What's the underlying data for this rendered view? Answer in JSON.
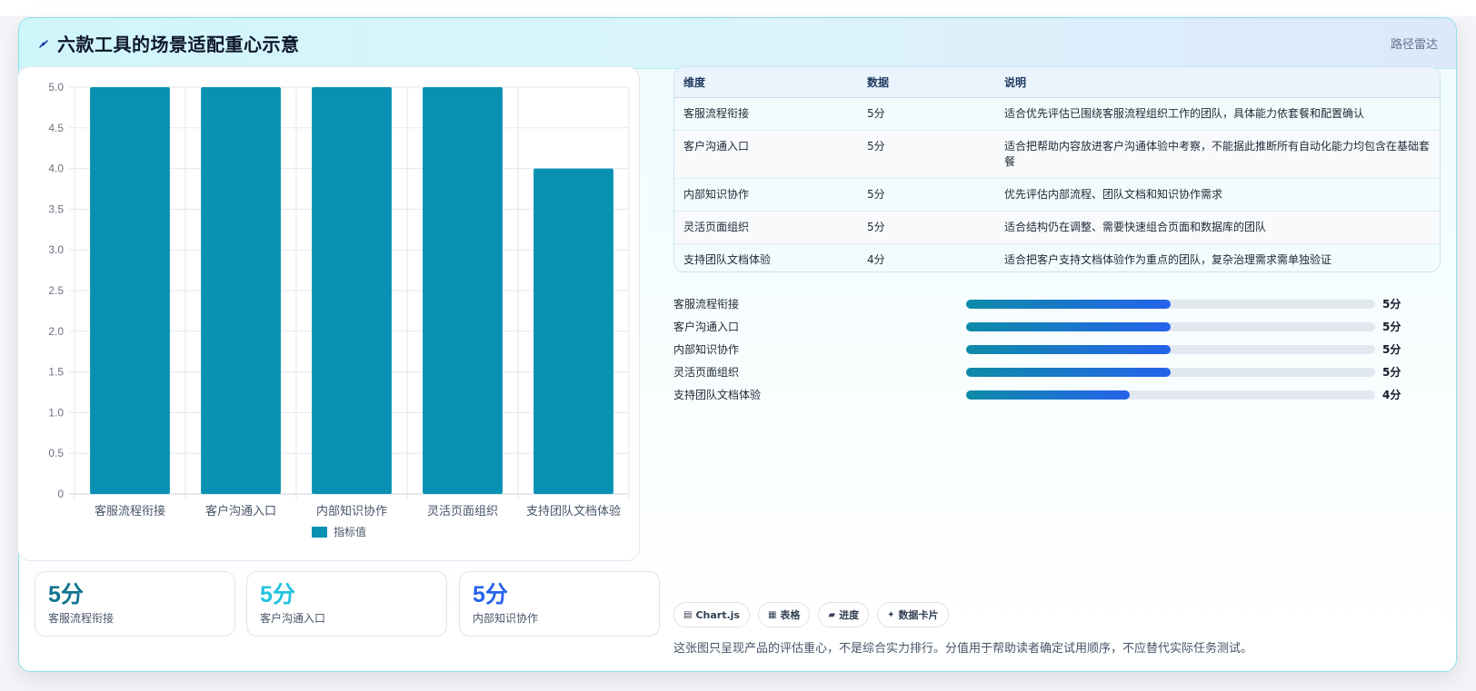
{
  "header": {
    "title": "六款工具的场景适配重心示意",
    "right_label": "路径雷达",
    "icon": "bolt-icon"
  },
  "chart_data": {
    "type": "bar",
    "categories": [
      "客服流程衔接",
      "客户沟通入口",
      "内部知识协作",
      "灵活页面组织",
      "支持团队文档体验"
    ],
    "series": [
      {
        "name": "指标值",
        "values": [
          5,
          5,
          5,
          5,
          4
        ],
        "color": "#0891b2"
      }
    ],
    "ylim": [
      0,
      5
    ],
    "yticks": [
      "0",
      "0.5",
      "1.0",
      "1.5",
      "2.0",
      "2.5",
      "3.0",
      "3.5",
      "4.0",
      "4.5",
      "5.0"
    ],
    "grid": true,
    "legend_position": "bottom"
  },
  "stats": [
    {
      "value": "5分",
      "label": "客服流程衔接",
      "color": "#0e7490"
    },
    {
      "value": "5分",
      "label": "客户沟通入口",
      "color": "#22c3e0"
    },
    {
      "value": "5分",
      "label": "内部知识协作",
      "color": "#2563eb"
    }
  ],
  "table": {
    "headers": [
      "维度",
      "数据",
      "说明"
    ],
    "rows": [
      [
        "客服流程衔接",
        "5分",
        "适合优先评估已围绕客服流程组织工作的团队，具体能力依套餐和配置确认"
      ],
      [
        "客户沟通入口",
        "5分",
        "适合把帮助内容放进客户沟通体验中考察，不能据此推断所有自动化能力均包含在基础套餐"
      ],
      [
        "内部知识协作",
        "5分",
        "优先评估内部流程、团队文档和知识协作需求"
      ],
      [
        "灵活页面组织",
        "5分",
        "适合结构仍在调整、需要快速组合页面和数据库的团队"
      ],
      [
        "支持团队文档体验",
        "4分",
        "适合把客户支持文档体验作为重点的团队，复杂治理需求需单独验证"
      ]
    ]
  },
  "progress": [
    {
      "label": "客服流程衔接",
      "value": 5,
      "max": 10,
      "display": "5分"
    },
    {
      "label": "客户沟通入口",
      "value": 5,
      "max": 10,
      "display": "5分"
    },
    {
      "label": "内部知识协作",
      "value": 5,
      "max": 10,
      "display": "5分"
    },
    {
      "label": "灵活页面组织",
      "value": 5,
      "max": 10,
      "display": "5分"
    },
    {
      "label": "支持团队文档体验",
      "value": 4,
      "max": 10,
      "display": "4分"
    }
  ],
  "tags": [
    {
      "icon": "chart-icon",
      "glyph": "▤",
      "label": "Chart.js"
    },
    {
      "icon": "table-icon",
      "glyph": "▦",
      "label": "表格"
    },
    {
      "icon": "progress-icon",
      "glyph": "▰",
      "label": "进度"
    },
    {
      "icon": "sparkle-icon",
      "glyph": "✦",
      "label": "数据卡片"
    }
  ],
  "footnote": "这张图只呈现产品的评估重心，不是综合实力排行。分值用于帮助读者确定试用顺序，不应替代实际任务测试。"
}
